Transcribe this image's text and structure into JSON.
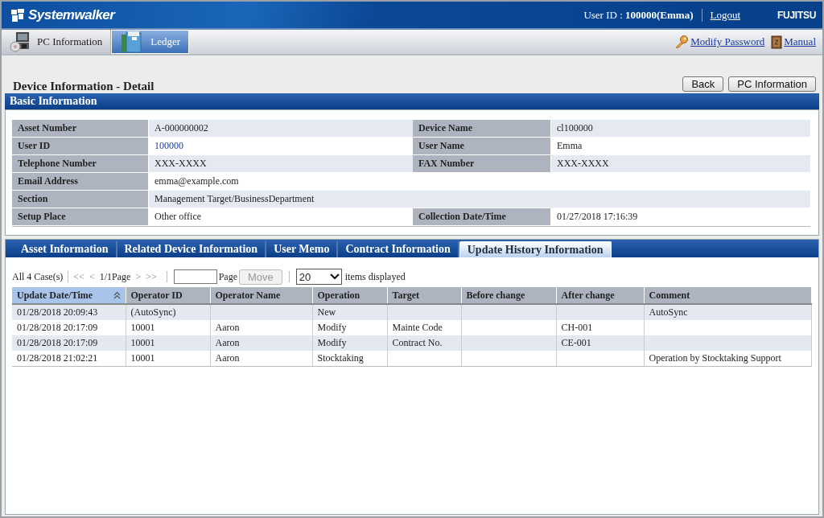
{
  "header": {
    "logo": "Systemwalker",
    "user": "User ID : **100000(Emma)**",
    "logout": "Logout",
    "brand": "FUJITSU"
  },
  "nav": {
    "tabs": [
      {
        "label": "PC Information",
        "selected": false
      },
      {
        "label": "Ledger",
        "selected": true
      }
    ],
    "links": [
      "Modify Password",
      "Manual"
    ]
  },
  "page": {
    "title": "Device Information - Detail",
    "buttons": [
      "Back",
      "PC Information"
    ]
  },
  "basic_info": {
    "title": "Basic Information",
    "rows": [
      [
        {
          "label": "Asset Number",
          "value": "A-000000002",
          "link": false
        },
        {
          "label": "Device Name",
          "value": "cl100000",
          "link": false
        }
      ],
      [
        {
          "label": "User ID",
          "value": "100000",
          "link": true
        },
        {
          "label": "User Name",
          "value": "Emma",
          "link": false
        }
      ],
      [
        {
          "label": "Telephone Number",
          "value": "XXX-XXXX",
          "link": false
        },
        {
          "label": "FAX Number",
          "value": "XXX-XXXX",
          "link": false
        }
      ],
      [
        {
          "label": "Email Address",
          "value": "emma@example.com",
          "link": false
        }
      ],
      [
        {
          "label": "Section",
          "value": "Management Target/BusinessDepartment",
          "link": false
        }
      ],
      [
        {
          "label": "Setup Place",
          "value": "Other office",
          "link": false
        },
        {
          "label": "Collection Date/Time",
          "value": "01/27/2018 17:16:39",
          "link": false
        }
      ]
    ]
  },
  "detail_tabs": [
    {
      "label": "Asset Information",
      "selected": false
    },
    {
      "label": "Related Device Information",
      "selected": false
    },
    {
      "label": "User Memo",
      "selected": false
    },
    {
      "label": "Contract Information",
      "selected": false
    },
    {
      "label": "Update History Information",
      "selected": true
    }
  ],
  "pager": {
    "count": "All 4 Case(s)",
    "first": "<<",
    "prev": "<",
    "page_info": "1/1Page",
    "next": ">",
    "last": ">>",
    "page_label": "Page",
    "move": {
      "label": "Move",
      "disabled": true
    },
    "per_page": "20",
    "per_page_label": "items displayed"
  },
  "table": {
    "columns": [
      {
        "label": "Update Date/Time",
        "sorted": true
      },
      {
        "label": "Operator ID",
        "sorted": false
      },
      {
        "label": "Operator Name",
        "sorted": false
      },
      {
        "label": "Operation",
        "sorted": false
      },
      {
        "label": "Target",
        "sorted": false
      },
      {
        "label": "Before change",
        "sorted": false
      },
      {
        "label": "After change",
        "sorted": false
      },
      {
        "label": "Comment",
        "sorted": false
      }
    ],
    "rows": [
      [
        "01/28/2018 20:09:43",
        "(AutoSync)",
        null,
        "New",
        null,
        null,
        null,
        "AutoSync"
      ],
      [
        "01/28/2018 20:17:09",
        "10001",
        "Aaron",
        "Modify",
        "Mainte Code",
        null,
        "CH-001",
        null
      ],
      [
        "01/28/2018 20:17:09",
        "10001",
        "Aaron",
        "Modify",
        "Contract No.",
        null,
        "CE-001",
        null
      ],
      [
        "01/28/2018 21:02:21",
        "10001",
        "Aaron",
        "Stocktaking",
        null,
        null,
        null,
        "Operation by Stocktaking Support"
      ]
    ]
  }
}
